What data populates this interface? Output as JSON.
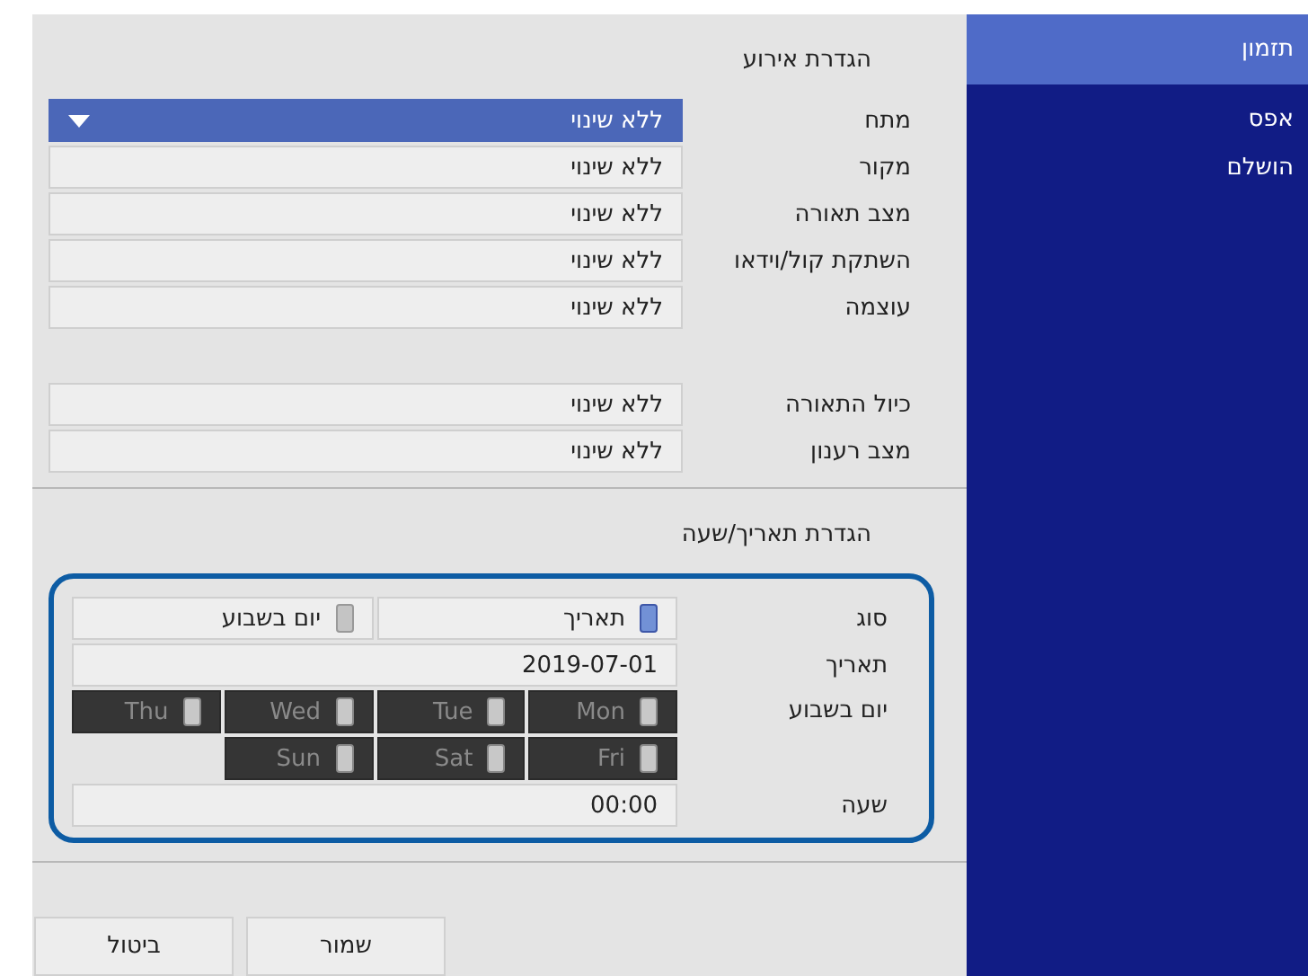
{
  "event": {
    "title": "הגדרת אירוע",
    "groups": [
      [
        {
          "label": "מתח",
          "value": "ללא שינוי",
          "focused": true
        },
        {
          "label": "מקור",
          "value": "ללא שינוי",
          "focused": false
        },
        {
          "label": "מצב תאורה",
          "value": "ללא שינוי",
          "focused": false
        },
        {
          "label": "השתקת קול/וידאו",
          "value": "ללא שינוי",
          "focused": false
        },
        {
          "label": "עוצמה",
          "value": "ללא שינוי",
          "focused": false
        }
      ],
      [
        {
          "label": "כיול התאורה",
          "value": "ללא שינוי",
          "focused": false
        },
        {
          "label": "מצב רענון",
          "value": "ללא שינוי",
          "focused": false
        }
      ]
    ]
  },
  "datetime": {
    "title": "הגדרת תאריך/שעה",
    "type": {
      "label": "סוג",
      "options": [
        {
          "label": "תאריך",
          "selected": true
        },
        {
          "label": "יום בשבוע",
          "selected": false
        }
      ]
    },
    "date": {
      "label": "תאריך",
      "value": "2019-07-01"
    },
    "weekday": {
      "label": "יום בשבוע",
      "disabled": true,
      "days": [
        {
          "label": "Mon",
          "checked": false
        },
        {
          "label": "Tue",
          "checked": false
        },
        {
          "label": "Wed",
          "checked": false
        },
        {
          "label": "Thu",
          "checked": false
        },
        {
          "label": "Fri",
          "checked": false
        },
        {
          "label": "Sat",
          "checked": false
        },
        {
          "label": "Sun",
          "checked": false
        }
      ]
    },
    "time": {
      "label": "שעה",
      "value": "00:00"
    }
  },
  "buttons": [
    {
      "label": "שמור"
    },
    {
      "label": "ביטול"
    }
  ],
  "sidebar": {
    "items": [
      {
        "label": "תזמון",
        "selected": true
      },
      {
        "label": "אפס",
        "selected": false
      },
      {
        "label": "הושלם",
        "selected": false
      }
    ]
  }
}
